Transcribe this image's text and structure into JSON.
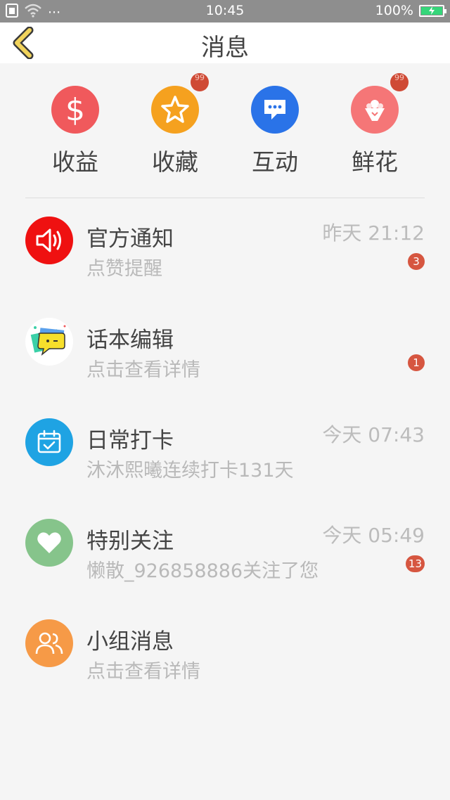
{
  "status_bar": {
    "time": "10:45",
    "battery": "100%",
    "dots": "···",
    "icons": [
      "sim-icon",
      "wifi-icon",
      "battery-icon"
    ]
  },
  "header": {
    "title": "消息",
    "back_icon": "chevron-left-icon"
  },
  "categories": [
    {
      "label": "收益",
      "icon": "dollar-icon",
      "color": "#f0595c"
    },
    {
      "label": "收藏",
      "icon": "star-icon",
      "color": "#f5a11f",
      "badge": "99"
    },
    {
      "label": "互动",
      "icon": "chat-bubble-icon",
      "color": "#2a73e8"
    },
    {
      "label": "鲜花",
      "icon": "bouquet-icon",
      "color": "#f57677",
      "badge": "99"
    }
  ],
  "messages": [
    {
      "title": "官方通知",
      "subtitle": "点赞提醒",
      "time": "昨天 21:12",
      "count": "3",
      "icon": "speaker-icon",
      "color": "#ef1111"
    },
    {
      "title": "话本编辑",
      "subtitle": "点击查看详情",
      "time": "",
      "count": "1",
      "icon": "editor-avatar-icon",
      "color": "#ffffff"
    },
    {
      "title": "日常打卡",
      "subtitle": "沐沐熙曦连续打卡131天",
      "time": "今天 07:43",
      "count": "",
      "icon": "calendar-check-icon",
      "color": "#1fa3e3"
    },
    {
      "title": "特别关注",
      "subtitle": "懒散_926858886关注了您",
      "time": "今天 05:49",
      "count": "13",
      "icon": "heart-icon",
      "color": "#86c48b"
    },
    {
      "title": "小组消息",
      "subtitle": "点击查看详情",
      "time": "",
      "count": "",
      "icon": "group-icon",
      "color": "#f69a47"
    }
  ]
}
